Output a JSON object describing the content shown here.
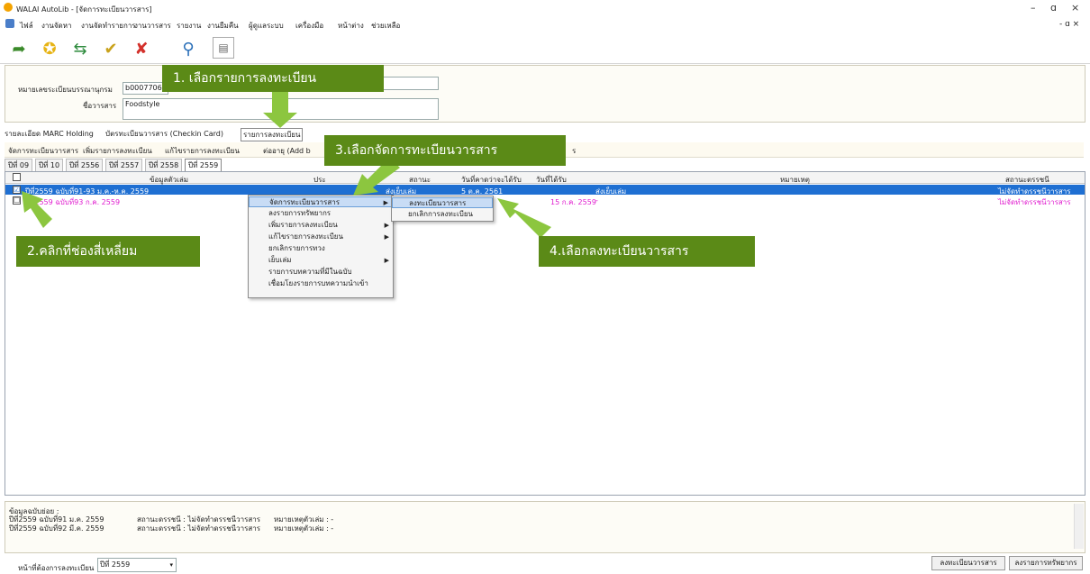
{
  "window": {
    "title": "WALAI AutoLib - [จัดการทะเบียนวารสาร]",
    "minimize": "–",
    "maximize": "ɑ",
    "close": "×",
    "doc_ctl": "- ɑ ×"
  },
  "menu": [
    "ไฟล์",
    "งานจัดหา",
    "งานจัดทำรายการ",
    "งานวารสาร",
    "รายงาน",
    "งานยืมคืน",
    "ผู้ดูแลระบบ",
    "เครื่องมือ",
    "หน้าต่าง",
    "ช่วยเหลือ"
  ],
  "toolbar_icons": [
    "back-icon",
    "star-icon",
    "exchange-icon",
    "checkmark-icon",
    "x-icon",
    "search-icon",
    "print-icon"
  ],
  "form": {
    "regno_label": "หมายเลขระเบียนบรรณานุกรม",
    "regno_value": "b0007706",
    "title_label": "ชื่อวารสาร",
    "title_value": "Foodstyle"
  },
  "tabs_main": [
    "รายละเอียด MARC Holding",
    "บัตรทะเบียนวารสาร (Checkin Card)",
    "รายการลงทะเบียน"
  ],
  "tabs_actions": [
    "จัดการทะเบียนวารสาร",
    "เพิ่มรายการลงทะเบียน",
    "แก้ไขรายการลงทะเบียน",
    "ต่ออายุ (Add b",
    "ร"
  ],
  "tabs_years": [
    "ปีที่ 09",
    "ปีที่ 10",
    "ปีที่ 2556",
    "ปีที่ 2557",
    "ปีที่ 2558",
    "ปีที่ 2559"
  ],
  "grid": {
    "headers": [
      "ข้อมูลตัวเล่ม",
      "ประ",
      "สถานะ",
      "วันที่คาดว่าจะได้รับ",
      "วันที่ได้รับ",
      "หมายเหตุ",
      "สถานะตรรชนี"
    ],
    "rows": [
      {
        "item": "ปีที่2559 ฉบับที่91-93 ม.ค.-ห.ค. 2559",
        "status": "ส่งเย็บเล่ม",
        "expected": "5 ต.ค. 2561",
        "received": "",
        "note": "ส่งเย็บเล่ม",
        "index": "ไม่จัดทำดรรชนีวารสาร",
        "checked": "☑"
      },
      {
        "item": "ปีที่2559 ฉบับที่93 ก.ค. 2559",
        "status": "",
        "expected": "",
        "received": "15 ก.ค. 2559",
        "note": "-",
        "index": "ไม่จัดทำดรรชนีวารสาร",
        "checked": "☐"
      }
    ]
  },
  "context_menu": [
    "จัดการทะเบียนวารสาร",
    "ลงรายการทรัพยากร",
    "เพิ่มรายการลงทะเบียน",
    "แก้ไขรายการลงทะเบียน",
    "ยกเลิกรายการทวง",
    "เย็บเล่ม",
    "รายการบทความที่มีในฉบับ",
    "เชื่อมโยงรายการบทความนำเข้า"
  ],
  "submenu": [
    "ลงทะเบียนวารสาร",
    "ยกเลิกการลงทะเบียน"
  ],
  "callouts": {
    "c1": "1. เลือกรายการลงทะเบียน",
    "c2": "2.คลิกที่ช่องสี่เหลี่ยม",
    "c3": "3.เลือกจัดการทะเบียนวารสาร",
    "c4": "4.เลือกลงทะเบียนวารสาร"
  },
  "bottom": {
    "header": "ข้อมูลฉบับย่อย :",
    "lines": [
      {
        "a": "ปีที่2559 ฉบับที่91 ม.ค. 2559",
        "b": "สถานะดรรชนี : ไม่จัดทำดรรชนีวารสาร",
        "c": "หมายเหตุตัวเล่ม : -"
      },
      {
        "a": "ปีที่2559 ฉบับที่92 มี.ค. 2559",
        "b": "สถานะดรรชนี : ไม่จัดทำดรรชนีวารสาร",
        "c": "หมายเหตุตัวเล่ม : -"
      }
    ]
  },
  "footer": {
    "page_label": "หน้าที่ต้องการลงทะเบียน",
    "page_value": "ปีที่ 2559",
    "btn_register": "ลงทะเบียนวารสาร",
    "btn_catalog": "ลงรายการทรัพยากร"
  },
  "colors": {
    "callout": "#5b8a17",
    "arrow": "#8cc63f",
    "selection": "#1e6fd2",
    "magenta": "#e01ccf"
  }
}
